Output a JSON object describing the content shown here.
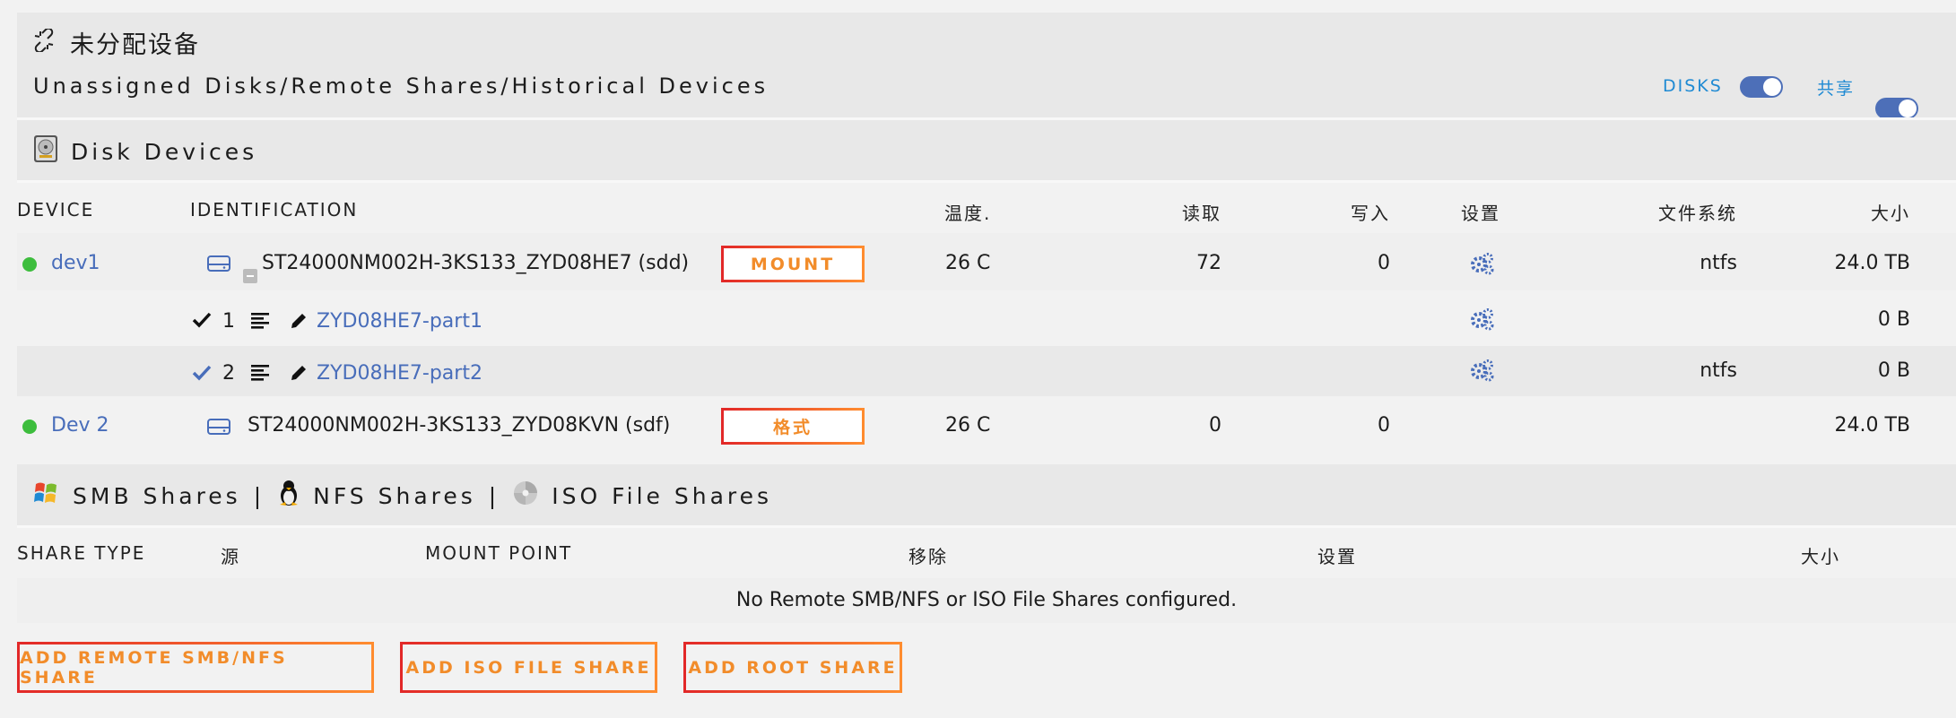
{
  "header": {
    "title": "未分配设备",
    "subtitle": "Unassigned Disks/Remote Shares/Historical Devices",
    "toggles": [
      {
        "label": "DISKS",
        "on": true
      },
      {
        "label": "共享",
        "on": true
      }
    ]
  },
  "disk_section": {
    "title": "Disk Devices",
    "columns": {
      "device": "DEVICE",
      "identification": "IDENTIFICATION",
      "temp": "温度.",
      "read": "读取",
      "write": "写入",
      "settings": "设置",
      "fs": "文件系统",
      "size": "大小"
    },
    "rows": [
      {
        "device": "dev1",
        "identification": "ST24000NM002H-3KS133_ZYD08HE7 (sdd)",
        "button": "MOUNT",
        "temp": "26 C",
        "read": "72",
        "write": "0",
        "fs": "ntfs",
        "size": "24.0 TB"
      },
      {
        "partition_num": "1",
        "partition_name": "ZYD08HE7-part1",
        "fs": "",
        "size": "0 B"
      },
      {
        "partition_num": "2",
        "partition_name": "ZYD08HE7-part2",
        "fs": "ntfs",
        "size": "0 B"
      },
      {
        "device": "Dev 2",
        "identification": "ST24000NM002H-3KS133_ZYD08KVN (sdf)",
        "button": "格式",
        "temp": "26 C",
        "read": "0",
        "write": "0",
        "fs": "",
        "size": "24.0 TB"
      }
    ]
  },
  "share_section": {
    "title_smb": "SMB Shares",
    "title_nfs": "NFS Shares",
    "title_iso": "ISO File Shares",
    "separator": "|",
    "columns": {
      "share_type": "SHARE TYPE",
      "source": "源",
      "mount_point": "MOUNT POINT",
      "remove": "移除",
      "settings": "设置",
      "size": "大小"
    },
    "empty_message": "No Remote SMB/NFS or ISO File Shares configured."
  },
  "actions": {
    "add_remote": "ADD REMOTE SMB/NFS SHARE",
    "add_iso": "ADD ISO FILE SHARE",
    "add_root": "ADD ROOT SHARE"
  },
  "colors": {
    "accent_link": "#486dba",
    "toggle_blue": "#4d6fb8",
    "button_orange": "#f28c2a",
    "button_red": "#e22828",
    "status_green": "#3dbd3d"
  }
}
